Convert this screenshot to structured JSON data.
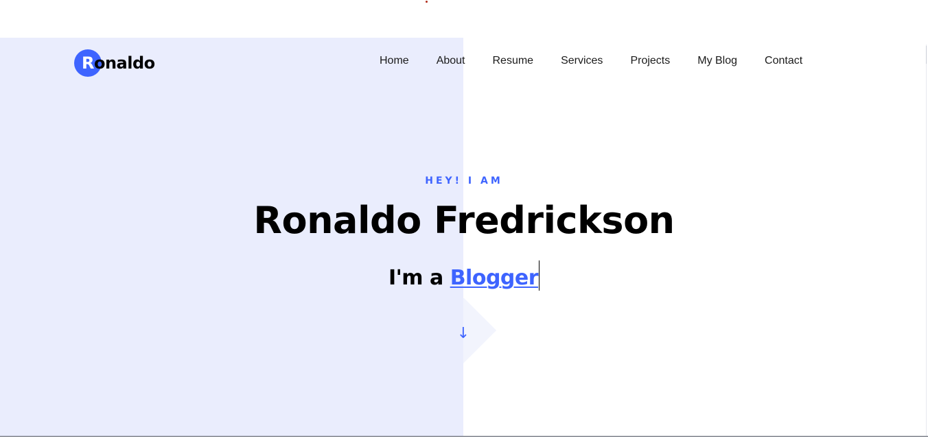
{
  "brand": {
    "logo_initial": "R",
    "logo_rest": "onaldo",
    "accent_color": "#3e64ff",
    "left_panel_color": "#eaedfd"
  },
  "nav": {
    "items": [
      {
        "label": "Home"
      },
      {
        "label": "About"
      },
      {
        "label": "Resume"
      },
      {
        "label": "Services"
      },
      {
        "label": "Projects"
      },
      {
        "label": "My Blog"
      },
      {
        "label": "Contact"
      }
    ]
  },
  "hero": {
    "subtitle": "HEY! I AM",
    "name": "Ronaldo Fredrickson",
    "role_prefix": "I'm a",
    "role_word": "Blogger",
    "scroll_icon": "arrow-down-icon"
  }
}
